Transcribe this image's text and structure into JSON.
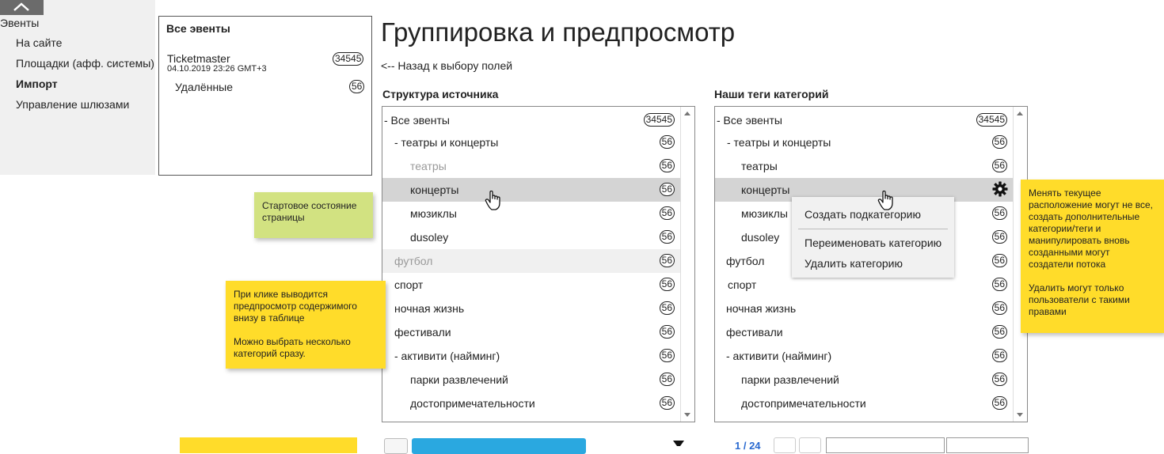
{
  "page": {
    "title": "Группировка и предпросмотр",
    "back_link": "<-- Назад к выбору полей"
  },
  "leftnav": {
    "root": "Эвенты",
    "items": [
      {
        "label": "На сайте"
      },
      {
        "label": "Площадки (афф. системы)"
      },
      {
        "label": "Импорт"
      },
      {
        "label": "Управление шлюзами"
      }
    ]
  },
  "events_box": {
    "title": "Все эвенты",
    "source_name": "Ticketmaster",
    "source_date": "04.10.2019 23:26 GMT+3",
    "source_count": "34545",
    "deleted_label": "Удалённые",
    "deleted_count": "56"
  },
  "source_panel": {
    "heading": "Структура источника",
    "rows": [
      {
        "label": "- Все эвенты",
        "count": "34545"
      },
      {
        "label": "- театры и концерты",
        "count": "56"
      },
      {
        "label": "театры",
        "count": "56"
      },
      {
        "label": "концерты",
        "count": "56"
      },
      {
        "label": "мюзиклы",
        "count": "56"
      },
      {
        "label": "dusoley",
        "count": "56"
      },
      {
        "label": "футбол",
        "count": "56"
      },
      {
        "label": "спорт",
        "count": "56"
      },
      {
        "label": "ночная жизнь",
        "count": "56"
      },
      {
        "label": "фестивали",
        "count": "56"
      },
      {
        "label": "- активити (найминг)",
        "count": "56"
      },
      {
        "label": "парки развлечений",
        "count": "56"
      },
      {
        "label": "достопримечательности",
        "count": "56"
      }
    ]
  },
  "tags_panel": {
    "heading": "Наши теги категорий",
    "rows": [
      {
        "label": "- Все эвенты",
        "count": "34545"
      },
      {
        "label": "- театры и концерты",
        "count": "56"
      },
      {
        "label": "театры",
        "count": "56"
      },
      {
        "label": "концерты",
        "count": ""
      },
      {
        "label": "мюзиклы",
        "count": "56"
      },
      {
        "label": "dusoley",
        "count": "56"
      },
      {
        "label": "футбол",
        "count": "56"
      },
      {
        "label": "спорт",
        "count": "56"
      },
      {
        "label": "ночная жизнь",
        "count": "56"
      },
      {
        "label": "фестивали",
        "count": "56"
      },
      {
        "label": "- активити (найминг)",
        "count": "56"
      },
      {
        "label": "парки развлечений",
        "count": "56"
      },
      {
        "label": "достопримечательности",
        "count": "56"
      }
    ]
  },
  "context_menu": {
    "items": [
      {
        "label": "Создать подкатегорию"
      },
      {
        "label": "Переименовать категорию"
      },
      {
        "label": "Удалить категорию"
      }
    ]
  },
  "notes": {
    "start_state": "Стартовое состояние страницы",
    "click_preview_1": "При клике выводится предпросмотр содержимого внизу в таблице",
    "click_preview_2": "Можно выбрать несколько категорий сразу.",
    "rights_1": "Менять текущее расположение могут не все, создать дополнительные категории/теги и манипулировать вновь созданными могут создатели потока",
    "rights_2": "Удалить могут только пользователи с такими правами"
  },
  "bottom": {
    "page_indicator": "1 / 24"
  },
  "colors": {
    "note_yellow": "#ffdc2a",
    "note_green": "#d2e281",
    "selected_row": "#d4d4d4",
    "primary_button": "#2aa8e0"
  }
}
